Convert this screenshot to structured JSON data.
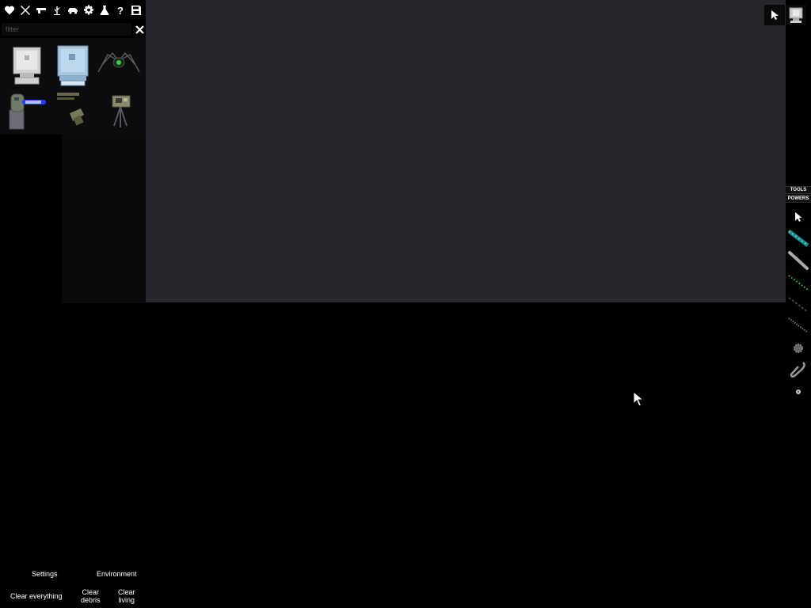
{
  "categories": [
    {
      "name": "biohazard-heart",
      "icon": "heart-icon"
    },
    {
      "name": "melee",
      "icon": "crossed-swords-icon"
    },
    {
      "name": "firearms",
      "icon": "pistol-icon"
    },
    {
      "name": "plants",
      "icon": "plant-icon"
    },
    {
      "name": "vehicles",
      "icon": "car-icon"
    },
    {
      "name": "machinery",
      "icon": "gear-icon"
    },
    {
      "name": "chemistry",
      "icon": "flask-icon"
    },
    {
      "name": "help",
      "icon": "question-icon"
    },
    {
      "name": "saves",
      "icon": "floppy-disk-icon"
    }
  ],
  "filter": {
    "placeholder": "filter",
    "value": ""
  },
  "items": [
    {
      "icon": "computer-monitor-icon",
      "color": "#d0d0d0"
    },
    {
      "icon": "computer-monitor-blue-icon",
      "color": "#8fb8d8"
    },
    {
      "icon": "spider-robot-icon",
      "color": "#2a9a3a"
    },
    {
      "icon": "laser-turret-icon",
      "color": "#3b5bff"
    },
    {
      "icon": "mounted-gun-icon",
      "color": "#7a7a4a"
    },
    {
      "icon": "camera-tripod-icon",
      "color": "#8a8a6a"
    }
  ],
  "toolbar": {
    "tools_label": "TOOLS",
    "powers_label": "POWERS",
    "tools": [
      {
        "icon": "pointer-cursor-icon"
      },
      {
        "icon": "cable-wire-icon",
        "color": "#2ab0b0"
      },
      {
        "icon": "rod-icon",
        "color": "#bbbbbb"
      },
      {
        "icon": "led-strip-icon",
        "color": "#3ad03a"
      },
      {
        "icon": "chain-icon",
        "color": "#555555"
      },
      {
        "icon": "rope-icon",
        "color": "#888888"
      },
      {
        "icon": "gear-hub-icon",
        "color": "#777777"
      },
      {
        "icon": "hook-icon",
        "color": "#999999"
      },
      {
        "icon": "small-dot-icon",
        "color": "#cccccc"
      }
    ]
  },
  "top_right": [
    {
      "icon": "pointer-cursor-icon"
    },
    {
      "icon": "android-head-icon"
    }
  ],
  "bottom_menu": {
    "settings": "Settings",
    "environment": "Environment",
    "clear_everything": "Clear everything",
    "clear_debris_1": "Clear",
    "clear_debris_2": "debris",
    "clear_living_1": "Clear",
    "clear_living_2": "living"
  },
  "colors": {
    "viewport": "#26272c",
    "background": "#000000",
    "panel": "#0c0c0e"
  }
}
